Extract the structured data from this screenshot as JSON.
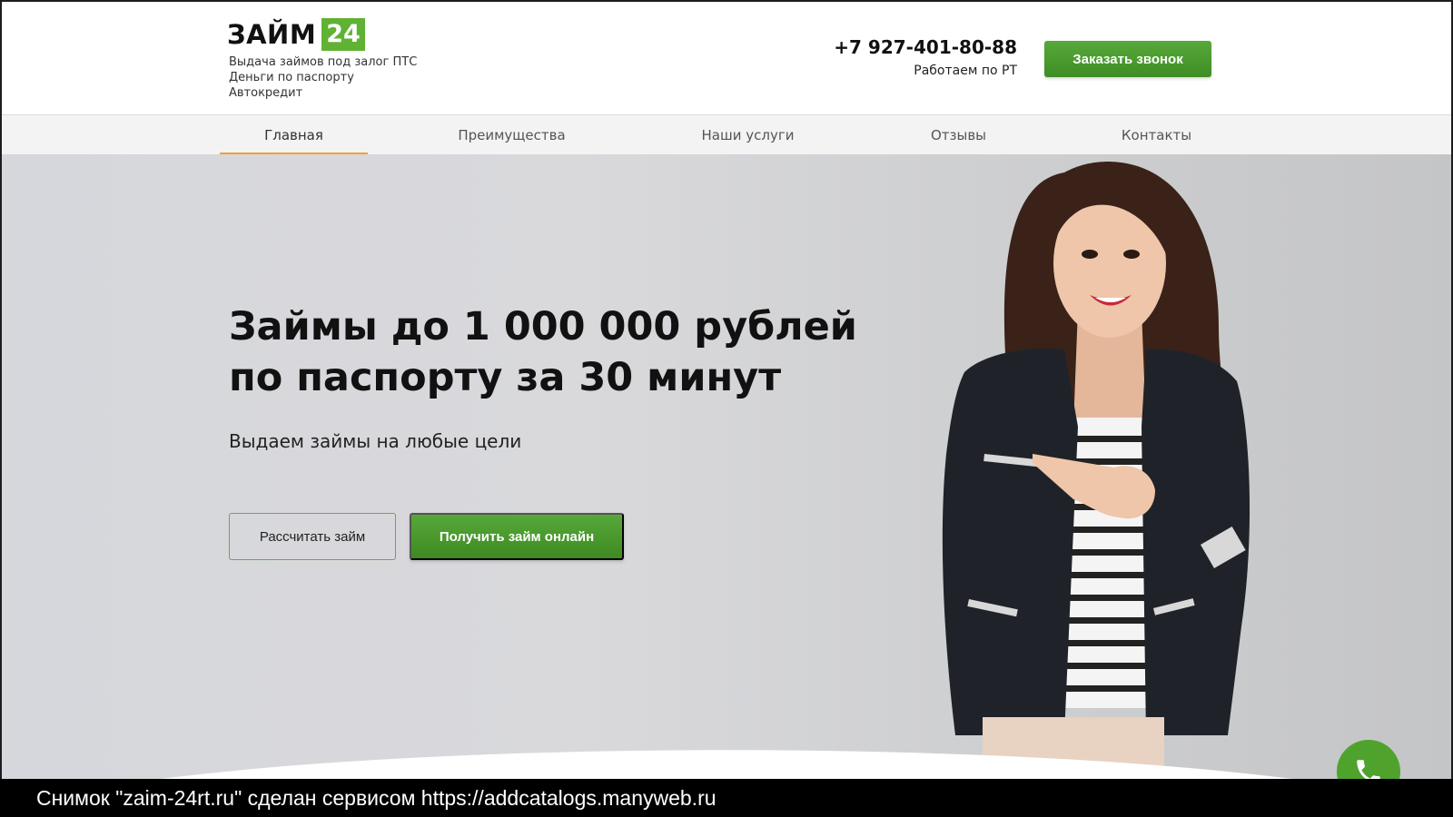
{
  "header": {
    "logo_word": "ЗАЙМ",
    "logo_num": "24",
    "tagline": [
      "Выдача займов под залог ПТС",
      "Деньги по паспорту",
      "Автокредит"
    ],
    "phone": "+7 927-401-80-88",
    "hours": "Работаем по РТ",
    "callback_label": "Заказать звонок"
  },
  "nav": {
    "items": [
      "Главная",
      "Преимущества",
      "Наши услуги",
      "Отзывы",
      "Контакты"
    ],
    "active": "Главная"
  },
  "hero": {
    "title_line1": "Займы до 1 000 000 рублей",
    "title_line2": "по паспорту за 30 минут",
    "subtitle": "Выдаем займы на любые цели",
    "calc_label": "Рассчитать займ",
    "online_label": "Получить займ онлайн"
  },
  "caption": "Снимок \"zaim-24rt.ru\" сделан сервисом https://addcatalogs.manyweb.ru",
  "colors": {
    "accent_green": "#4fa32d",
    "nav_underline": "#f0a13a"
  },
  "icons": {
    "fab": "phone-icon"
  }
}
